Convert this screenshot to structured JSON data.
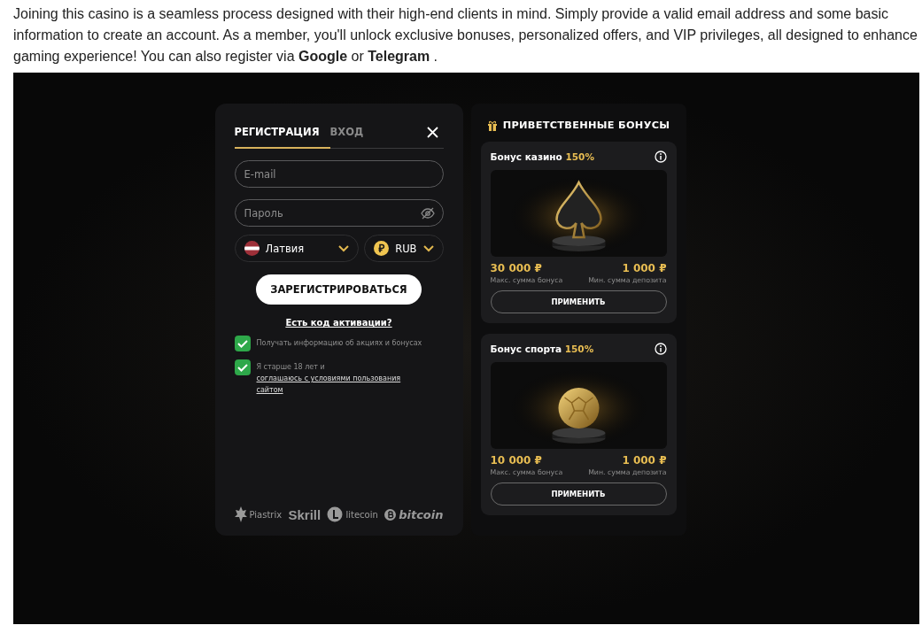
{
  "article": {
    "paragraph": "Joining this casino is a seamless process designed with their high-end clients in mind. Simply provide a valid email address and some basic information to create an account. As a member, you'll unlock exclusive bonuses, personalized offers, and VIP privileges, all designed to enhance gaming experience! You can also register via **Google** or **Telegram** ."
  },
  "registration": {
    "tabs": [
      {
        "label": "РЕГИСТРАЦИЯ",
        "selected": true
      },
      {
        "label": "ВХОД",
        "selected": false
      }
    ],
    "email": {
      "placeholder": "E-mail"
    },
    "password": {
      "placeholder": "Пароль"
    },
    "country": "Латвия",
    "currency": "RUB",
    "register_button": "ЗАРЕГИСТРИРОВАТЬСЯ",
    "activation_link": "Есть код активации?",
    "checkboxes": [
      {
        "text": "Получать информацию об акциях и бонусах",
        "checked": true
      },
      {
        "text": "Я старше 18 лет и",
        "link": "соглашаюсь с условиями пользования сайтом",
        "checked": true
      }
    ],
    "payment_logos": [
      {
        "kind": "piastrix",
        "label": "Piastrix"
      },
      {
        "kind": "skrill",
        "label": "Skrill"
      },
      {
        "kind": "litecoin",
        "label": "litecoin"
      },
      {
        "kind": "bitcoin",
        "label": "bitcoin"
      }
    ]
  },
  "bonuses": {
    "title": "ПРИВЕТСТВЕННЫЕ БОНУСЫ",
    "cards": [
      {
        "kind": "casino",
        "title": "Бонус казино",
        "percent": "150%",
        "max_amount": "30 000 ₽",
        "max_label": "Макс. сумма бонуса",
        "min_amount": "1 000 ₽",
        "min_label": "Мин. сумма депозита",
        "button": "ПРИМЕНИТЬ"
      },
      {
        "kind": "sport",
        "title": "Бонус спорта",
        "percent": "150%",
        "max_amount": "10 000 ₽",
        "max_label": "Макс. сумма бонуса",
        "min_amount": "1 000 ₽",
        "min_label": "Мин. сумма депозита",
        "button": "ПРИМЕНИТЬ"
      }
    ]
  }
}
